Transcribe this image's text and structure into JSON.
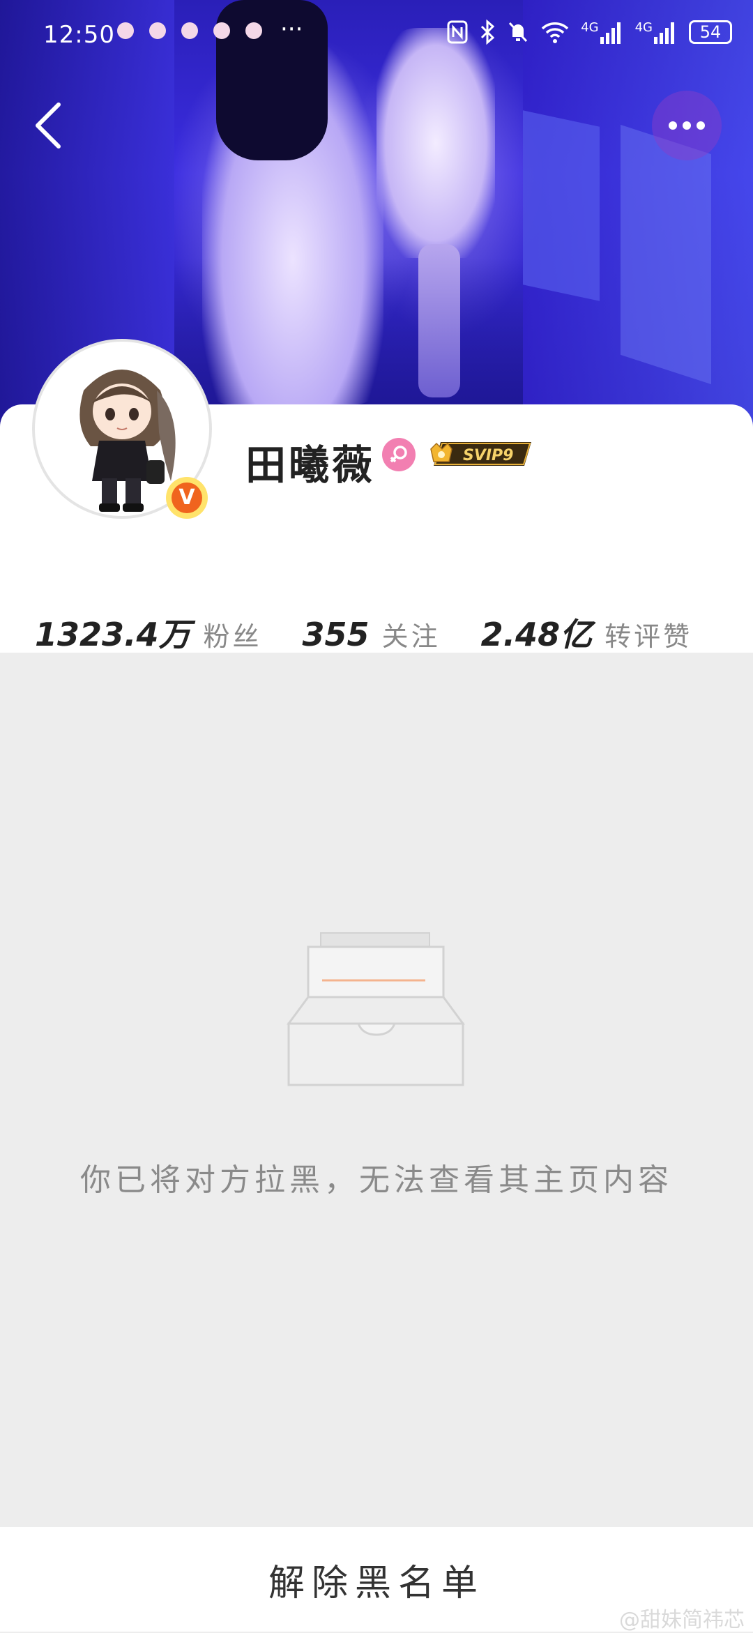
{
  "status_bar": {
    "time": "12:50",
    "overflow": "···",
    "network_1": "4G",
    "network_2": "4G",
    "battery": "54"
  },
  "header": {
    "back_icon": "chevron-left-icon",
    "more_icon": "more-horizontal-icon"
  },
  "profile": {
    "name": "田曦薇",
    "gender": "female",
    "verified_badge": "V",
    "vip_badge": "SVIP9",
    "stats": [
      {
        "value": "1323.4万",
        "label": "粉丝"
      },
      {
        "value": "355",
        "label": "关注"
      },
      {
        "value": "2.48亿",
        "label": "转评赞"
      }
    ]
  },
  "blocked_state": {
    "icon": "empty-inbox-icon",
    "message": "你已将对方拉黑，无法查看其主页内容"
  },
  "footer": {
    "unblock_label": "解除黑名单"
  },
  "watermark": "@甜妹简祎芯",
  "colors": {
    "accent_orange": "#f0641e",
    "gender_pink": "#f27fb1",
    "hero_blue": "#3b2de0"
  }
}
